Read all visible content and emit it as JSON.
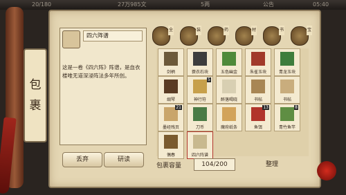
{
  "topbar": {
    "left": "20/180",
    "money": "27万985文",
    "energy": "5两",
    "notice": "公告",
    "time": "05:40"
  },
  "side_tab": "包裹",
  "detail": {
    "name": "四六阵谱",
    "desc": "这是一卷《四六阵》阵谱，是血衣楼唯无道深浸阵法多年所创。"
  },
  "buttons": {
    "discard": "丢弃",
    "study": "研读",
    "sort": "整理"
  },
  "categories": [
    {
      "tag": "全",
      "icon": "bag-icon"
    },
    {
      "tag": "装",
      "icon": "equipment-icon"
    },
    {
      "tag": "药",
      "icon": "medicine-icon"
    },
    {
      "tag": "材",
      "icon": "material-icon"
    },
    {
      "tag": "书",
      "icon": "book-icon"
    },
    {
      "tag": "宝",
      "icon": "treasure-icon"
    }
  ],
  "items": [
    {
      "name": "剑柄",
      "count": ""
    },
    {
      "name": "蓑衣石块",
      "count": ""
    },
    {
      "name": "五色幽金",
      "count": ""
    },
    {
      "name": "朱雀玉块",
      "count": ""
    },
    {
      "name": "青龙玉块",
      "count": ""
    },
    {
      "name": "绸琴",
      "count": ""
    },
    {
      "name": "神行符",
      "count": "5"
    },
    {
      "name": "醉落喝晓",
      "count": ""
    },
    {
      "name": "书帖",
      "count": ""
    },
    {
      "name": "书帖",
      "count": ""
    },
    {
      "name": "墨经残页",
      "count": "21"
    },
    {
      "name": "刀币",
      "count": ""
    },
    {
      "name": "魔府纸条",
      "count": ""
    },
    {
      "name": "鱼饵",
      "count": "13"
    },
    {
      "name": "青竹鱼竿",
      "count": "8"
    },
    {
      "name": "偶春",
      "count": ""
    },
    {
      "name": "四六阵谱",
      "count": ""
    }
  ],
  "capacity": {
    "label": "包裹容量",
    "value": "104/200"
  },
  "colors": {
    "panel": "#e4d6b3",
    "slot": "#f4ead0",
    "accent": "#a0261c"
  }
}
